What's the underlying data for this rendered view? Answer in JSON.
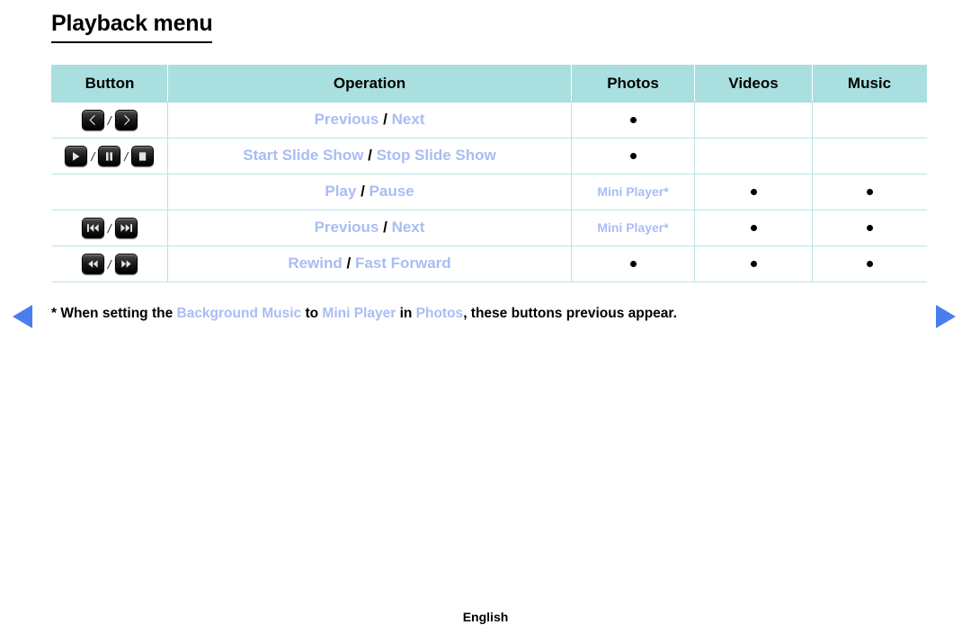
{
  "page": {
    "title": "Playback menu",
    "footer_language": "English"
  },
  "nav": {
    "prev_icon": "triangle-left-icon",
    "next_icon": "triangle-right-icon",
    "accent_color": "#4a7ef0"
  },
  "table": {
    "headers": [
      "Button",
      "Operation",
      "Photos",
      "Videos",
      "Music"
    ],
    "header_bg": "#aadfdf",
    "border_color": "#b8e4e4",
    "link_color": "#a9bdf4",
    "rows": [
      {
        "buttons": [
          "chevron-left-button",
          "chevron-right-button"
        ],
        "button_separators": [
          "/"
        ],
        "operation": [
          {
            "text": "Previous",
            "style": "link"
          },
          {
            "text": "/",
            "style": "sep"
          },
          {
            "text": "Next",
            "style": "link"
          }
        ],
        "photos": {
          "type": "dot",
          "text": ""
        },
        "videos": {
          "type": "empty",
          "text": ""
        },
        "music": {
          "type": "empty",
          "text": ""
        }
      },
      {
        "buttons": [
          "play-button",
          "pause-button",
          "stop-button"
        ],
        "button_separators": [
          "/",
          "/"
        ],
        "operation": [
          {
            "text": "Start Slide Show",
            "style": "link"
          },
          {
            "text": "/",
            "style": "sep"
          },
          {
            "text": "Stop Slide Show",
            "style": "link"
          }
        ],
        "photos": {
          "type": "dot",
          "text": ""
        },
        "videos": {
          "type": "empty",
          "text": ""
        },
        "music": {
          "type": "empty",
          "text": ""
        }
      },
      {
        "buttons": [],
        "button_separators": [],
        "operation": [
          {
            "text": "Play",
            "style": "link"
          },
          {
            "text": "/",
            "style": "sep"
          },
          {
            "text": "Pause",
            "style": "link"
          }
        ],
        "photos": {
          "type": "text",
          "text": "Mini Player*"
        },
        "videos": {
          "type": "dot",
          "text": ""
        },
        "music": {
          "type": "dot",
          "text": ""
        }
      },
      {
        "buttons": [
          "skip-previous-button",
          "skip-next-button"
        ],
        "button_separators": [
          "/"
        ],
        "operation": [
          {
            "text": "Previous",
            "style": "link"
          },
          {
            "text": "/",
            "style": "sep"
          },
          {
            "text": "Next",
            "style": "link"
          }
        ],
        "photos": {
          "type": "text",
          "text": "Mini Player*"
        },
        "videos": {
          "type": "dot",
          "text": ""
        },
        "music": {
          "type": "dot",
          "text": ""
        }
      },
      {
        "buttons": [
          "rewind-button",
          "fast-forward-button"
        ],
        "button_separators": [
          "/"
        ],
        "operation": [
          {
            "text": "Rewind",
            "style": "link"
          },
          {
            "text": "/",
            "style": "sep"
          },
          {
            "text": "Fast Forward",
            "style": "link"
          }
        ],
        "photos": {
          "type": "dot",
          "text": ""
        },
        "videos": {
          "type": "dot",
          "text": ""
        },
        "music": {
          "type": "dot",
          "text": ""
        }
      }
    ]
  },
  "footnote": {
    "parts": [
      {
        "text": "* When setting the ",
        "style": "plain"
      },
      {
        "text": "Background Music",
        "style": "highlight"
      },
      {
        "text": " to ",
        "style": "plain"
      },
      {
        "text": "Mini Player",
        "style": "highlight"
      },
      {
        "text": " in ",
        "style": "plain"
      },
      {
        "text": "Photos",
        "style": "highlight"
      },
      {
        "text": ", these buttons previous appear.",
        "style": "plain"
      }
    ]
  }
}
